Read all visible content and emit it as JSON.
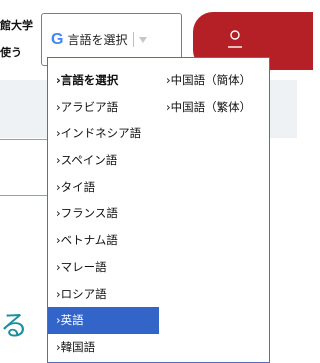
{
  "page": {
    "university_fragment": "館大学",
    "use_fragment": "使う",
    "teal_fragment": "る"
  },
  "translate_widget": {
    "logo_letter": "G",
    "select_label": "言語を選択"
  },
  "menu": {
    "column1": [
      {
        "label": "›言語を選択",
        "bold": true
      },
      {
        "label": "›アラビア語"
      },
      {
        "label": "›インドネシア語"
      },
      {
        "label": "›スペイン語"
      },
      {
        "label": "›タイ語"
      },
      {
        "label": "›フランス語"
      },
      {
        "label": "›ベトナム語"
      },
      {
        "label": "›マレー語"
      },
      {
        "label": "›ロシア語"
      },
      {
        "label": "›英語",
        "selected": true
      },
      {
        "label": "›韓国語"
      }
    ],
    "column2": [
      {
        "label": "›中国語（簡体）"
      },
      {
        "label": "›中国語（繁体）"
      }
    ]
  },
  "colors": {
    "selected_bg": "#3364c7",
    "account_button": "#b51f26",
    "google_blue": "#4285f4",
    "teal_text": "#1a8fa0"
  }
}
